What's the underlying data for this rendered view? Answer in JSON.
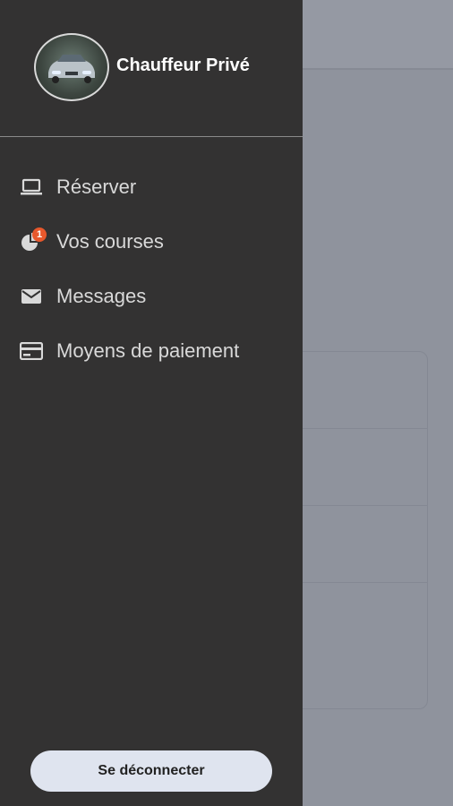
{
  "drawer": {
    "brand_title": "Chauffeur Privé",
    "menu": [
      {
        "label": "Réserver",
        "icon": "laptop-icon"
      },
      {
        "label": "Vos courses",
        "icon": "pie-chart-icon",
        "badge": "1"
      },
      {
        "label": "Messages",
        "icon": "mail-icon"
      },
      {
        "label": "Moyens de paiement",
        "icon": "credit-card-icon"
      }
    ],
    "logout_label": "Se déconnecter"
  },
  "colors": {
    "drawer_bg": "#333232",
    "overlay_bg": "#8f939d",
    "badge": "#e8582c",
    "logout_bg": "#dfe4ef"
  }
}
